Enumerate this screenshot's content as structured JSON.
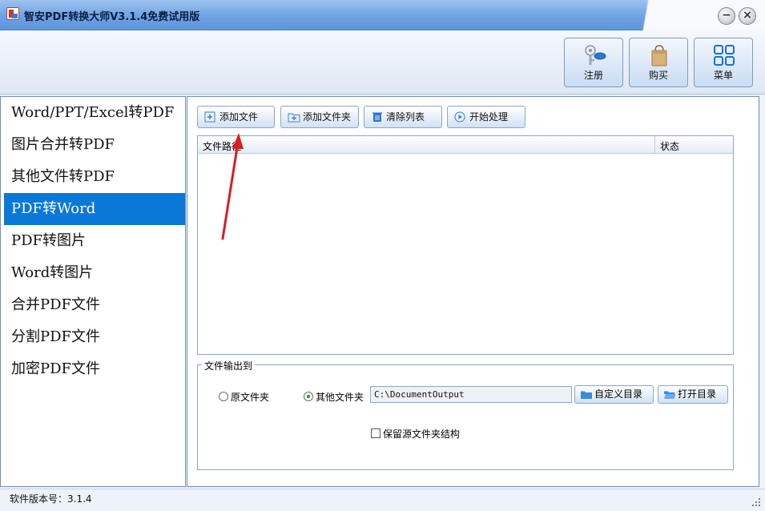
{
  "window": {
    "title": "智安PDF转换大师V3.1.4免费试用版",
    "minimize_label": "−",
    "close_label": "×"
  },
  "toolbar": {
    "register_label": "注册",
    "buy_label": "购买",
    "menu_label": "菜单"
  },
  "nav": {
    "items": [
      "Word/PPT/Excel转PDF",
      "图片合并转PDF",
      "其他文件转PDF",
      "PDF转Word",
      "PDF转图片",
      "Word转图片",
      "合并PDF文件",
      "分割PDF文件",
      "加密PDF文件"
    ],
    "active_index": 3
  },
  "actions": {
    "add_file": "添加文件",
    "add_folder": "添加文件夹",
    "clear_list": "清除列表",
    "start": "开始处理"
  },
  "file_list": {
    "col_path": "文件路径",
    "col_status": "状态"
  },
  "output": {
    "legend": "文件输出到",
    "original_folder": "原文件夹",
    "other_folder": "其他文件夹",
    "selected": "other_folder",
    "path": "C:\\DocumentOutput",
    "custom_dir": "自定义目录",
    "open_dir": "打开目录",
    "keep_structure": "保留源文件夹结构",
    "keep_structure_checked": false
  },
  "status": {
    "version": "软件版本号：3.1.4"
  },
  "colors": {
    "accent": "#0a78d6",
    "title_bar": "#6fa3e3"
  }
}
